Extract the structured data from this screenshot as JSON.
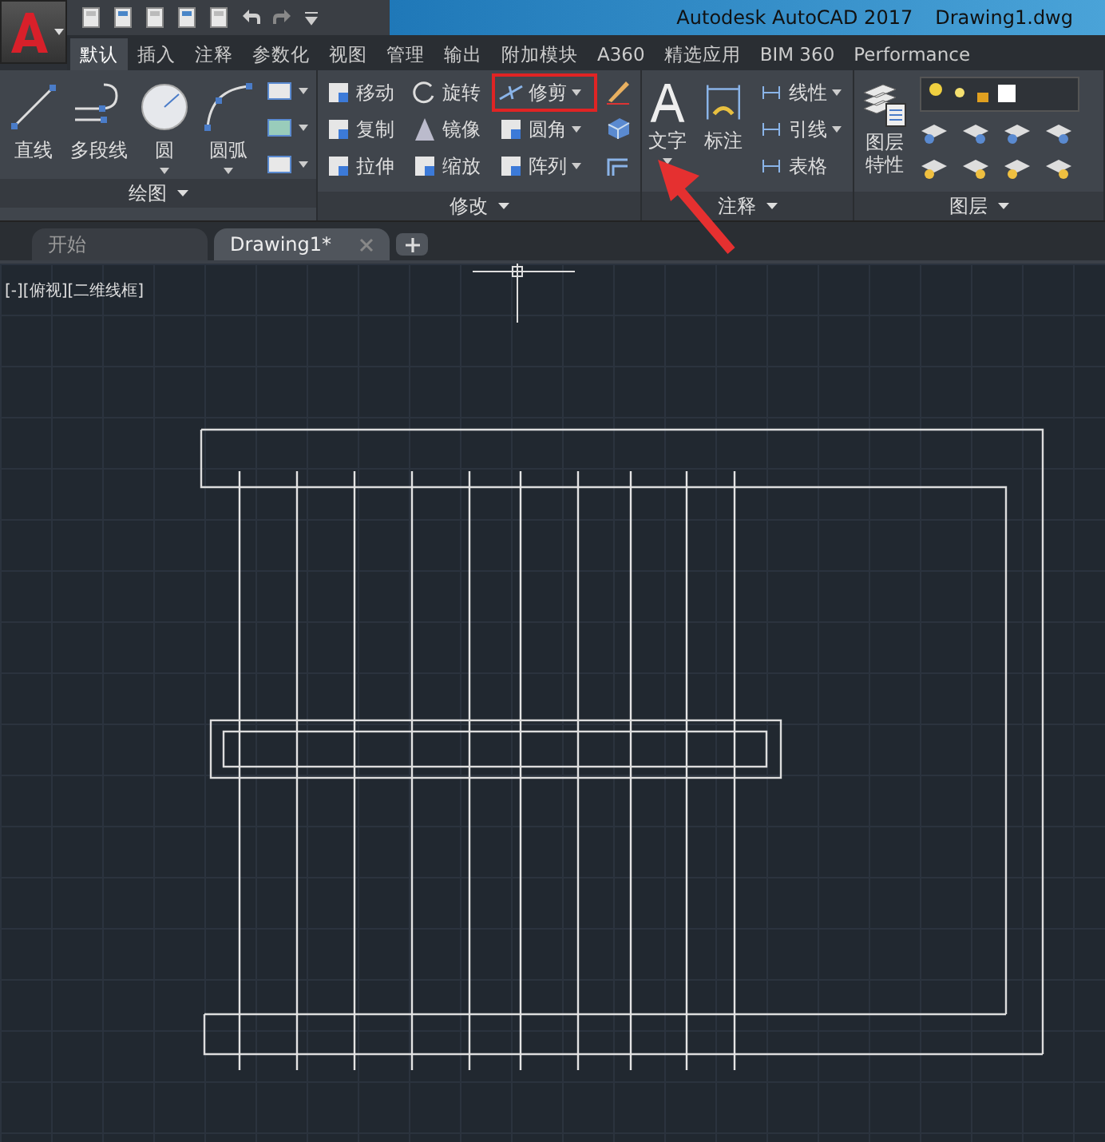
{
  "app_title": "Autodesk AutoCAD 2017",
  "file_name": "Drawing1.dwg",
  "ribbon_tabs": [
    {
      "label": "默认",
      "selected": true
    },
    {
      "label": "插入",
      "selected": false
    },
    {
      "label": "注释",
      "selected": false
    },
    {
      "label": "参数化",
      "selected": false
    },
    {
      "label": "视图",
      "selected": false
    },
    {
      "label": "管理",
      "selected": false
    },
    {
      "label": "输出",
      "selected": false
    },
    {
      "label": "附加模块",
      "selected": false
    },
    {
      "label": "A360",
      "selected": false
    },
    {
      "label": "精选应用",
      "selected": false
    },
    {
      "label": "BIM 360",
      "selected": false
    },
    {
      "label": "Performance",
      "selected": false
    }
  ],
  "panels": [
    {
      "kind": "draw",
      "title": "绘图",
      "tools": [
        {
          "label": "直线",
          "dropdown": false
        },
        {
          "label": "多段线",
          "dropdown": false
        },
        {
          "label": "圆",
          "dropdown": true
        },
        {
          "label": "圆弧",
          "dropdown": true
        }
      ]
    },
    {
      "kind": "modify",
      "title": "修改",
      "tools": [
        {
          "label": "移动",
          "dropdown": false,
          "highlighted": false
        },
        {
          "label": "旋转",
          "dropdown": false,
          "highlighted": false
        },
        {
          "label": "修剪",
          "dropdown": true,
          "highlighted": true
        },
        {
          "label": "复制",
          "dropdown": false,
          "highlighted": false
        },
        {
          "label": "镜像",
          "dropdown": false,
          "highlighted": false
        },
        {
          "label": "圆角",
          "dropdown": true,
          "highlighted": false
        },
        {
          "label": "拉伸",
          "dropdown": false,
          "highlighted": false
        },
        {
          "label": "缩放",
          "dropdown": false,
          "highlighted": false
        },
        {
          "label": "阵列",
          "dropdown": true,
          "highlighted": false
        }
      ]
    },
    {
      "kind": "annotate",
      "title": "注释",
      "tools": [
        {
          "label": "文字",
          "dropdown": true
        },
        {
          "label": "标注",
          "dropdown": false
        },
        {
          "label": "线性",
          "dropdown": true
        },
        {
          "label": "引线",
          "dropdown": true
        },
        {
          "label": "表格",
          "dropdown": false
        }
      ]
    },
    {
      "kind": "layers",
      "title": "图层",
      "tools": [
        {
          "label": "图层特性",
          "dropdown": false
        }
      ]
    }
  ],
  "doc_tabs": [
    {
      "label": "开始",
      "selected": false
    },
    {
      "label": "Drawing1*",
      "selected": true
    }
  ],
  "viewport_label": "[-][俯视][二维线框]"
}
